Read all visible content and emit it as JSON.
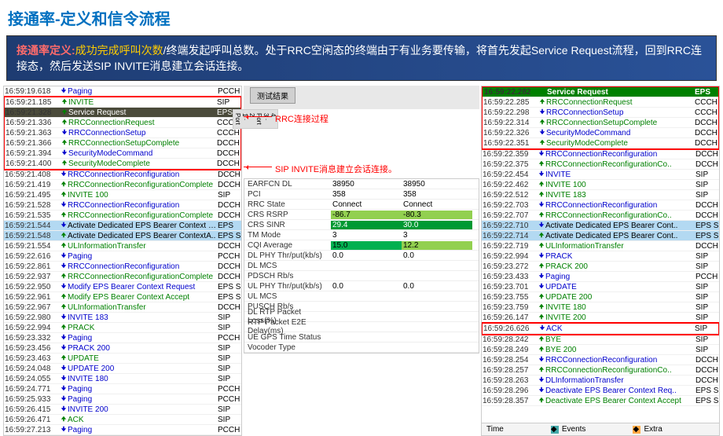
{
  "title": "接通率-定义和信令流程",
  "banner": {
    "prefix": "接通率定义:",
    "mid": "成功完成呼叫次数",
    "suffix": "/终端发起呼叫总数。处于RRC空闲态的终端由于有业务要传输，将首先发起Service Request流程，回到RRC连接态，然后发送SIP INVITE消息建立会话连接。"
  },
  "tab": "测试结果",
  "annot1": "RRC连接过程",
  "annot2": "SIP INVITE消息建立会话连接。",
  "leftLog": [
    {
      "t": "16:59:19.618",
      "d": "dn",
      "m": "Paging",
      "c": "PCCH"
    },
    {
      "t": "16:59:21.185",
      "d": "up",
      "m": "INVITE",
      "c": "SIP",
      "box": "start"
    },
    {
      "t": "16:59:21.328",
      "d": "up",
      "m": "Service Request",
      "c": "EPS",
      "hl": "dark"
    },
    {
      "t": "16:59:21.336",
      "d": "up",
      "m": "RRCConnectionRequest",
      "c": "CCCH"
    },
    {
      "t": "16:59:21.363",
      "d": "dn",
      "m": "RRCConnectionSetup",
      "c": "CCCH"
    },
    {
      "t": "16:59:21.366",
      "d": "up",
      "m": "RRCConnectionSetupComplete",
      "c": "DCCH"
    },
    {
      "t": "16:59:21.394",
      "d": "dn",
      "m": "SecurityModeCommand",
      "c": "DCCH"
    },
    {
      "t": "16:59:21.400",
      "d": "up",
      "m": "SecurityModeComplete",
      "c": "DCCH",
      "box": "end"
    },
    {
      "t": "16:59:21.408",
      "d": "dn",
      "m": "RRCConnectionReconfiguration",
      "c": "DCCH"
    },
    {
      "t": "16:59:21.419",
      "d": "up",
      "m": "RRCConnectionReconfigurationComplete",
      "c": "DCCH"
    },
    {
      "t": "16:59:21.495",
      "d": "up",
      "m": "INVITE 100",
      "c": "SIP"
    },
    {
      "t": "16:59:21.528",
      "d": "dn",
      "m": "RRCConnectionReconfiguration",
      "c": "DCCH"
    },
    {
      "t": "16:59:21.535",
      "d": "up",
      "m": "RRCConnectionReconfigurationComplete",
      "c": "DCCH"
    },
    {
      "t": "16:59:21.544",
      "d": "dn",
      "m": "Activate Dedicated EPS Bearer Context R..",
      "c": "EPS",
      "hl": "blue"
    },
    {
      "t": "16:59:21.548",
      "d": "up",
      "m": "Activate Dedicated EPS Bearer ContextA..",
      "c": "EPS S",
      "hl": "blue"
    },
    {
      "t": "16:59:21.554",
      "d": "up",
      "m": "ULInformationTransfer",
      "c": "DCCH"
    },
    {
      "t": "16:59:22.616",
      "d": "dn",
      "m": "Paging",
      "c": "PCCH"
    },
    {
      "t": "16:59:22.861",
      "d": "dn",
      "m": "RRCConnectionReconfiguration",
      "c": "DCCH"
    },
    {
      "t": "16:59:22.937",
      "d": "up",
      "m": "RRCConnectionReconfigurationComplete",
      "c": "DCCH"
    },
    {
      "t": "16:59:22.950",
      "d": "dn",
      "m": "Modify EPS Bearer Context Request",
      "c": "EPS S"
    },
    {
      "t": "16:59:22.961",
      "d": "up",
      "m": "Modify EPS Bearer Context Accept",
      "c": "EPS S"
    },
    {
      "t": "16:59:22.967",
      "d": "up",
      "m": "ULInformationTransfer",
      "c": "DCCH"
    },
    {
      "t": "16:59:22.980",
      "d": "dn",
      "m": "INVITE 183",
      "c": "SIP"
    },
    {
      "t": "16:59:22.994",
      "d": "up",
      "m": "PRACK",
      "c": "SIP"
    },
    {
      "t": "16:59:23.332",
      "d": "dn",
      "m": "Paging",
      "c": "PCCH"
    },
    {
      "t": "16:59:23.456",
      "d": "dn",
      "m": "PRACK 200",
      "c": "SIP"
    },
    {
      "t": "16:59:23.463",
      "d": "up",
      "m": "UPDATE",
      "c": "SIP"
    },
    {
      "t": "16:59:24.048",
      "d": "dn",
      "m": "UPDATE 200",
      "c": "SIP"
    },
    {
      "t": "16:59:24.055",
      "d": "dn",
      "m": "INVITE 180",
      "c": "SIP"
    },
    {
      "t": "16:59:24.771",
      "d": "dn",
      "m": "Paging",
      "c": "PCCH"
    },
    {
      "t": "16:59:25.933",
      "d": "dn",
      "m": "Paging",
      "c": "PCCH"
    },
    {
      "t": "16:59:26.415",
      "d": "dn",
      "m": "INVITE 200",
      "c": "SIP"
    },
    {
      "t": "16:59:26.471",
      "d": "up",
      "m": "ACK",
      "c": "SIP"
    },
    {
      "t": "16:59:27.213",
      "d": "dn",
      "m": "Paging",
      "c": "PCCH"
    }
  ],
  "rightLog": [
    {
      "t": "16:59:22.282",
      "d": "up",
      "m": "Service Request",
      "c": "EPS",
      "hl": "green",
      "box": "start"
    },
    {
      "t": "16:59:22.285",
      "d": "up",
      "m": "RRCConnectionRequest",
      "c": "CCCH"
    },
    {
      "t": "16:59:22.298",
      "d": "dn",
      "m": "RRCConnectionSetup",
      "c": "CCCH"
    },
    {
      "t": "16:59:22.314",
      "d": "up",
      "m": "RRCConnectionSetupComplete",
      "c": "DCCH"
    },
    {
      "t": "16:59:22.326",
      "d": "dn",
      "m": "SecurityModeCommand",
      "c": "DCCH"
    },
    {
      "t": "16:59:22.351",
      "d": "up",
      "m": "SecurityModeComplete",
      "c": "DCCH",
      "box": "end"
    },
    {
      "t": "16:59:22.359",
      "d": "dn",
      "m": "RRCConnectionReconfiguration",
      "c": "DCCH"
    },
    {
      "t": "16:59:22.375",
      "d": "up",
      "m": "RRCConnectionReconfigurationCo..",
      "c": "DCCH"
    },
    {
      "t": "16:59:22.454",
      "d": "dn",
      "m": "INVITE",
      "c": "SIP"
    },
    {
      "t": "16:59:22.462",
      "d": "up",
      "m": "INVITE 100",
      "c": "SIP"
    },
    {
      "t": "16:59:22.512",
      "d": "up",
      "m": "INVITE 183",
      "c": "SIP"
    },
    {
      "t": "16:59:22.703",
      "d": "dn",
      "m": "RRCConnectionReconfiguration",
      "c": "DCCH"
    },
    {
      "t": "16:59:22.707",
      "d": "up",
      "m": "RRCConnectionReconfigurationCo..",
      "c": "DCCH"
    },
    {
      "t": "16:59:22.710",
      "d": "dn",
      "m": "Activate Dedicated EPS Bearer Cont..",
      "c": "EPS S",
      "hl": "blue"
    },
    {
      "t": "16:59:22.714",
      "d": "up",
      "m": "Activate Dedicated EPS Bearer Cont..",
      "c": "EPS S",
      "hl": "blue"
    },
    {
      "t": "16:59:22.719",
      "d": "up",
      "m": "ULInformationTransfer",
      "c": "DCCH"
    },
    {
      "t": "16:59:22.994",
      "d": "dn",
      "m": "PRACK",
      "c": "SIP"
    },
    {
      "t": "16:59:23.272",
      "d": "up",
      "m": "PRACK 200",
      "c": "SIP"
    },
    {
      "t": "16:59:23.433",
      "d": "dn",
      "m": "Paging",
      "c": "PCCH"
    },
    {
      "t": "16:59:23.701",
      "d": "dn",
      "m": "UPDATE",
      "c": "SIP"
    },
    {
      "t": "16:59:23.755",
      "d": "up",
      "m": "UPDATE 200",
      "c": "SIP"
    },
    {
      "t": "16:59:23.759",
      "d": "up",
      "m": "INVITE 180",
      "c": "SIP"
    },
    {
      "t": "16:59:26.147",
      "d": "up",
      "m": "INVITE 200",
      "c": "SIP"
    },
    {
      "t": "16:59:26.626",
      "d": "dn",
      "m": "ACK",
      "c": "SIP",
      "box": "bottomend"
    },
    {
      "t": "16:59:28.242",
      "d": "up",
      "m": "BYE",
      "c": "SIP"
    },
    {
      "t": "16:59:28.249",
      "d": "up",
      "m": "BYE 200",
      "c": "SIP"
    },
    {
      "t": "16:59:28.254",
      "d": "dn",
      "m": "RRCConnectionReconfiguration",
      "c": "DCCH"
    },
    {
      "t": "16:59:28.257",
      "d": "up",
      "m": "RRCConnectionReconfigurationCo..",
      "c": "DCCH"
    },
    {
      "t": "16:59:28.263",
      "d": "dn",
      "m": "DLInformationTransfer",
      "c": "DCCH"
    },
    {
      "t": "16:59:28.296",
      "d": "dn",
      "m": "Deactivate EPS Bearer Context Req..",
      "c": "EPS S"
    },
    {
      "t": "16:59:28.357",
      "d": "up",
      "m": "Deactivate EPS Bearer Context Accept",
      "c": "EPS S"
    }
  ],
  "kv": [
    {
      "k": "EARFCN DL",
      "v1": "38950",
      "v2": "38950"
    },
    {
      "k": "PCI",
      "v1": "358",
      "v2": "358"
    },
    {
      "k": "RRC State",
      "v1": "Connect",
      "v2": "Connect"
    },
    {
      "k": "CRS RSRP",
      "v1": "-86.7",
      "v2": "-80.3",
      "c1": "lgreen",
      "c2": "lgreen"
    },
    {
      "k": "CRS SINR",
      "v1": "29.4",
      "v2": "30.0",
      "c1": "dgreen",
      "c2": "dgreen"
    },
    {
      "k": "TM Mode",
      "v1": "3",
      "v2": "3"
    },
    {
      "k": "CQI Average",
      "v1": "15.0",
      "v2": "12.2",
      "c1": "green",
      "c2": "lgreen"
    },
    {
      "k": "DL PHY Thr/put(kb/s)",
      "v1": "0.0",
      "v2": "0.0"
    },
    {
      "k": "DL MCS"
    },
    {
      "k": "PDSCH Rb/s"
    },
    {
      "k": "UL PHY Thr/put(kb/s)",
      "v1": "0.0",
      "v2": "0.0"
    },
    {
      "k": "UL MCS"
    },
    {
      "k": "PUSCH Rb/s"
    },
    {
      "k": "DL RTP Packet Loss(%)"
    },
    {
      "k": "RTP Packet E2E Delay(ms)"
    },
    {
      "k": "UE GPS Time Status"
    },
    {
      "k": "Vocoder Type"
    }
  ],
  "footer": {
    "time": "Time",
    "events": "Events",
    "extra": "Extra"
  }
}
